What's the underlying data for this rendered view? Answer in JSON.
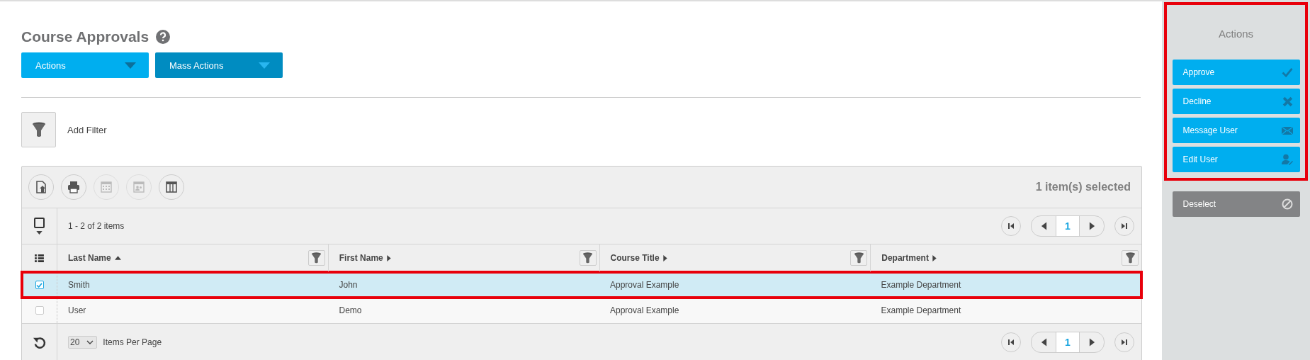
{
  "page_title": "Course Approvals",
  "dropdowns": [
    {
      "label": "Actions",
      "kind": "primary"
    },
    {
      "label": "Mass Actions",
      "kind": "secondary"
    }
  ],
  "filter": {
    "label": "Add Filter"
  },
  "grid": {
    "toolbar": [
      {
        "disabled": false
      },
      {
        "disabled": false
      },
      {
        "disabled": true
      },
      {
        "disabled": true
      },
      {
        "disabled": false
      }
    ],
    "selection_summary": "1 item(s) selected",
    "range": "1 - 2 of 2 items",
    "page": "1",
    "select_all_checked": false,
    "columns": [
      {
        "label": "Last Name",
        "sorted_ascending": true
      },
      {
        "label": "First Name",
        "sorted_ascending": false
      },
      {
        "label": "Course Title",
        "sorted_ascending": false
      },
      {
        "label": "Department",
        "sorted_ascending": false
      }
    ],
    "rows": [
      {
        "selected": true,
        "highlighted": true,
        "cells": [
          "Smith",
          "John",
          "Approval Example",
          "Example Department"
        ]
      },
      {
        "selected": false,
        "highlighted": false,
        "cells": [
          "User",
          "Demo",
          "Approval Example",
          "Example Department"
        ]
      }
    ],
    "per_page": "20",
    "per_page_label": "Items Per Page",
    "footer_page": "1"
  },
  "sidebar": {
    "title": "Actions",
    "highlighted": true,
    "actions": [
      {
        "label": "Approve"
      },
      {
        "label": "Decline"
      },
      {
        "label": "Message User"
      },
      {
        "label": "Edit User"
      }
    ],
    "deselect": {
      "label": "Deselect"
    }
  }
}
